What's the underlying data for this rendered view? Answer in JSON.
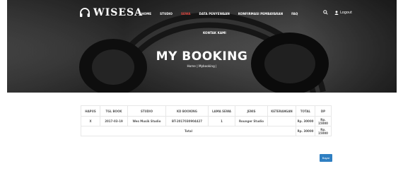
{
  "brand": {
    "logo_text": "WISESA"
  },
  "nav": {
    "items": [
      {
        "label": "HOME",
        "active": false
      },
      {
        "label": "STUDIO",
        "active": false
      },
      {
        "label": "SEWA",
        "active": true
      },
      {
        "label": "DATA PENYEWAAN",
        "active": false
      },
      {
        "label": "KONFIRMASI PEMBAYARAN",
        "active": false
      },
      {
        "label": "FAQ",
        "active": false
      }
    ],
    "second_row": "KONTAK KAMI",
    "logout_label": "Logout"
  },
  "hero": {
    "title": "MY BOOKING",
    "breadcrumb": "Home | Mybooking |"
  },
  "table": {
    "headers": [
      "HAPUS",
      "TGL BOOK",
      "STUDIO",
      "KD BOOKING",
      "LAMA SEWA",
      "JENIS",
      "KETERANGAN",
      "TOTAL",
      "DP"
    ],
    "rows": [
      [
        "X",
        "2017-03-19",
        "Wes Musik Studio",
        "BT-2017030904427",
        "1",
        "Rounger Studio",
        "",
        "Rp. 30000",
        "Rp. 15000"
      ]
    ],
    "total_label": "Total",
    "total_value": "Rp. 30000",
    "total_dp": "Rp. 15000"
  },
  "actions": {
    "pay_button": "Bayar"
  },
  "colors": {
    "active_nav": "#e0443e",
    "button": "#2f7fc2"
  }
}
